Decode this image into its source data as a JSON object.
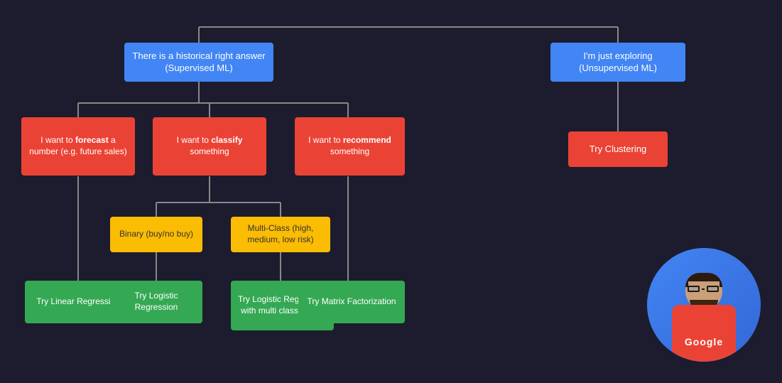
{
  "nodes": {
    "root": {
      "label": ""
    },
    "supervised": {
      "label": "There is a historical right answer (Supervised ML)"
    },
    "unsupervised": {
      "label": "I'm just exploring (Unsupervised ML)"
    },
    "forecast": {
      "label": "I want to forecast a number (e.g. future sales)"
    },
    "classify": {
      "label": "I want to classify something"
    },
    "recommend": {
      "label": "I want to recommend something"
    },
    "binary": {
      "label": "Binary (buy/no buy)"
    },
    "multiclass": {
      "label": "Multi-Class (high, medium, low risk)"
    },
    "linearReg": {
      "label": "Try Linear Regression"
    },
    "logisticReg": {
      "label": "Try Logistic Regression"
    },
    "logisticMulti": {
      "label": "Try Logistic Regression with multi class option"
    },
    "matrix": {
      "label": "Try Matrix Factorization"
    },
    "clustering": {
      "label": "Try Clustering"
    }
  },
  "colors": {
    "blue": "#4285f4",
    "red": "#ea4335",
    "green": "#34a853",
    "yellow": "#fbbc04",
    "connector": "#888888",
    "background": "#1c1c2e"
  },
  "avatar": {
    "google_label": "Google"
  }
}
